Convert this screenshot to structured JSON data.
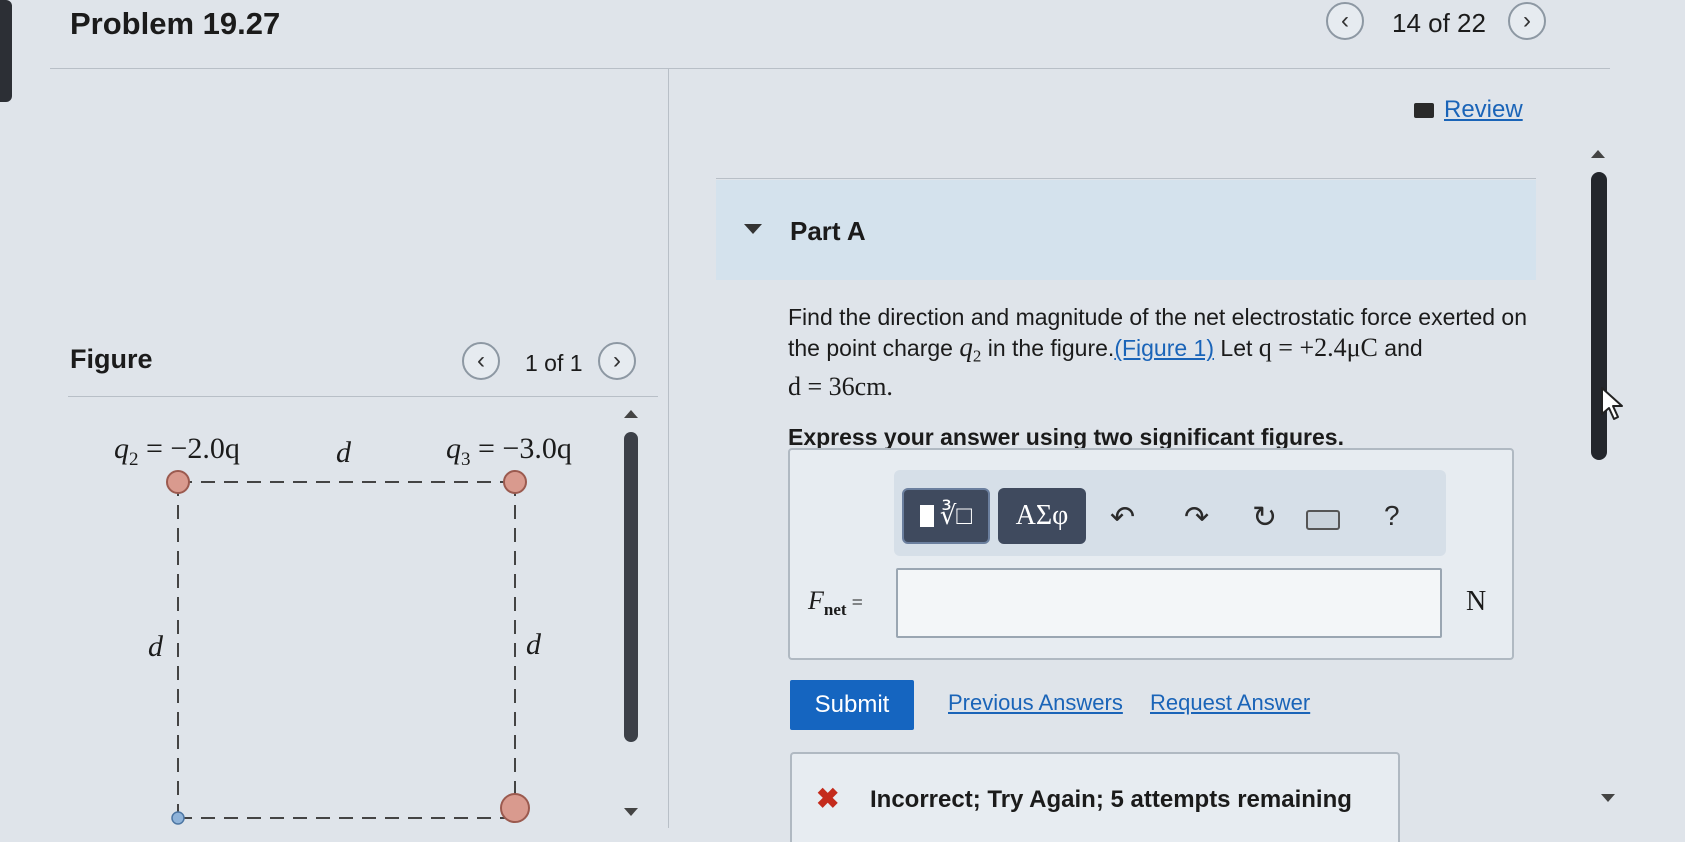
{
  "header": {
    "title": "Problem 19.27",
    "pager": "14 of 22"
  },
  "review_label": "Review",
  "figure": {
    "heading": "Figure",
    "pager": "1 of 1",
    "q2": "q",
    "q2_sub": "2",
    "q2_value": " = −2.0q",
    "q3": "q",
    "q3_sub": "3",
    "q3_value": " = −3.0q",
    "d_top": "d",
    "d_left": "d",
    "d_right": "d"
  },
  "part": {
    "label": "Part A"
  },
  "question": {
    "line1": "Find the direction and magnitude of the net electrostatic force exerted on",
    "line2_pre": "the point charge ",
    "charge": "q",
    "charge_sub": "2",
    "line2_mid": " in the figure.",
    "figure_link": "(Figure 1)",
    "let_text": " Let ",
    "q_eq": "q = +2.4μC",
    "and_text": " and",
    "d_eq": "d = 36cm.",
    "instruction": "Express your answer using two significant figures."
  },
  "toolbar": {
    "templates_label": "∛□",
    "greek_label": "ΑΣφ",
    "help_label": "?"
  },
  "answer": {
    "label_main": "F",
    "label_sub": "net",
    "equals": " =",
    "value": "",
    "unit": "N"
  },
  "actions": {
    "submit": "Submit",
    "previous_answers": "Previous Answers",
    "request_answer": "Request Answer"
  },
  "feedback": {
    "message": "Incorrect; Try Again; 5 attempts remaining"
  },
  "colors": {
    "accent": "#1a64b8",
    "submit": "#1565c0",
    "toolbar_btn": "#3f4a5e",
    "error": "#c42b1c",
    "charge_fill": "#d99a8e"
  }
}
